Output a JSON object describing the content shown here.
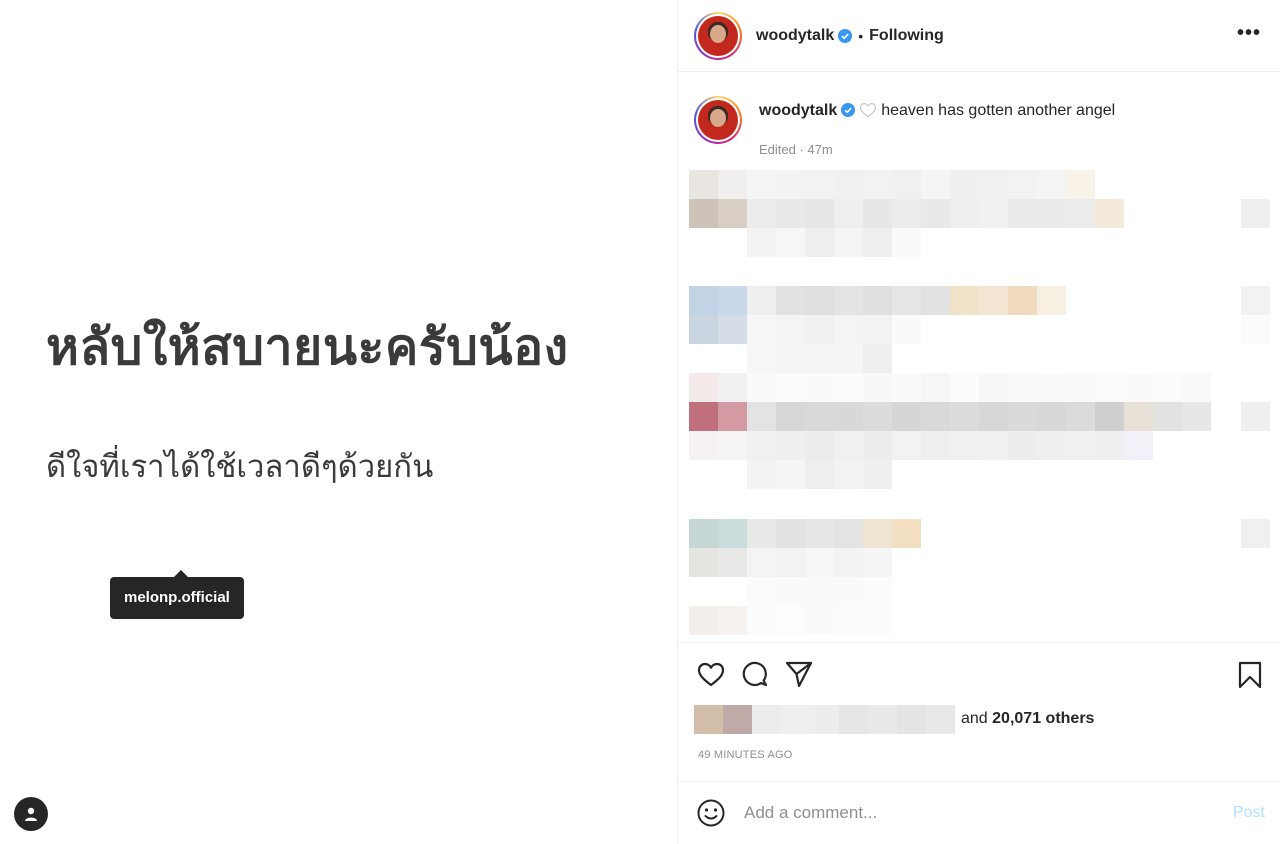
{
  "media": {
    "headline": "หลับให้สบายนะครับน้อง",
    "subline": "ดีใจที่เราได้ใช้เวลาดีๆด้วยกัน",
    "tag_label": "melonp.official"
  },
  "header": {
    "username": "woodytalk",
    "separator": "•",
    "follow_status": "Following",
    "more_label": "•••"
  },
  "caption": {
    "username": "woodytalk",
    "text": "heaven has gotten another angel",
    "meta": "Edited · 47m"
  },
  "likes": {
    "prefix": "and",
    "count": "20,071 others"
  },
  "timestamp": "49 MINUTES AGO",
  "comment": {
    "placeholder": "Add a comment...",
    "post_label": "Post"
  },
  "colors": {
    "verified": "#3897f0",
    "post_button": "#b2dffc",
    "text": "#262626",
    "muted": "#8e8e8e"
  }
}
